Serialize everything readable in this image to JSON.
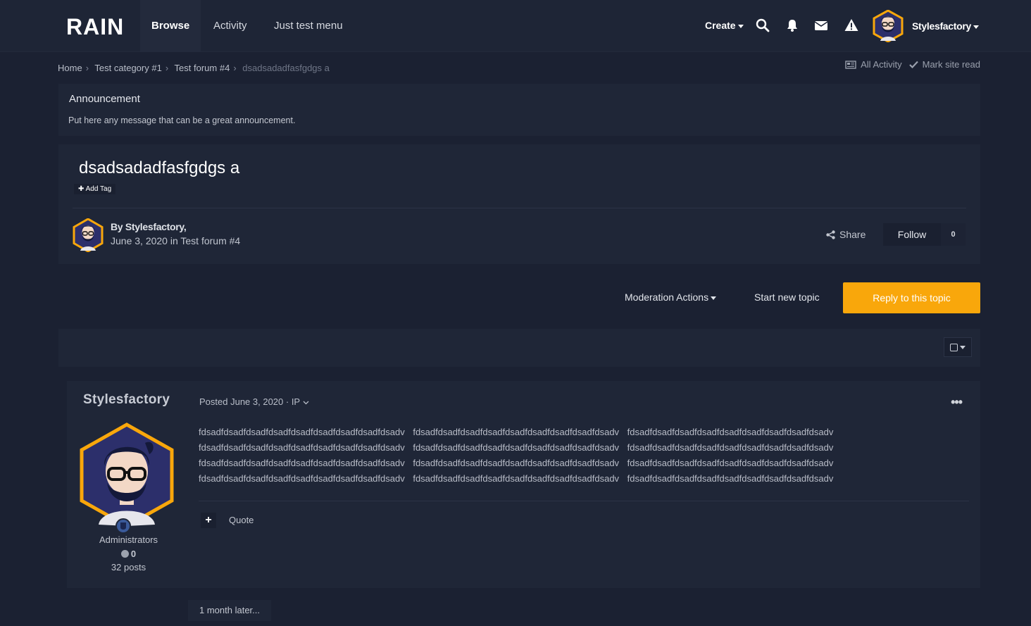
{
  "header": {
    "logo": "RAIN",
    "nav": [
      {
        "label": "Browse",
        "active": true
      },
      {
        "label": "Activity",
        "active": false
      },
      {
        "label": "Just test menu",
        "active": false
      }
    ],
    "create_label": "Create",
    "username": "Stylesfactory",
    "icons": [
      "search-icon",
      "bell-icon",
      "envelope-icon",
      "warning-icon"
    ]
  },
  "breadcrumb": {
    "items": [
      "Home",
      "Test category #1",
      "Test forum #4",
      "dsadsadadfasfgdgs a"
    ],
    "all_activity": "All Activity",
    "mark_read": "Mark site read"
  },
  "announcement": {
    "title": "Announcement",
    "message": "Put here any message that can be a great announcement."
  },
  "topic": {
    "title": "dsadsadadfasfgdgs a",
    "add_tag": "Add Tag",
    "author_by": "By Stylesfactory,",
    "author_meta": "June 3, 2020 in Test forum #4",
    "share_label": "Share",
    "follow_label": "Follow",
    "follow_count": "0"
  },
  "actions": {
    "moderation": "Moderation Actions",
    "start_topic": "Start new topic",
    "reply": "Reply to this topic"
  },
  "post": {
    "author": "Stylesfactory",
    "posted": "Posted June 3, 2020 · IP",
    "menu": "•••",
    "role": "Administrators",
    "reputation": "0",
    "posts": "32 posts",
    "body_lines": [
      "fdsadfdsadfdsadfdsadfdsadfdsadfdsadfdsadfdsadv fdsadfdsadfdsadfdsadfdsadfdsadfdsadfdsadfdsadv fdsadfdsadfdsadfdsadfdsadfdsadfdsadfdsadfdsadv",
      "fdsadfdsadfdsadfdsadfdsadfdsadfdsadfdsadfdsadv fdsadfdsadfdsadfdsadfdsadfdsadfdsadfdsadfdsadv fdsadfdsadfdsadfdsadfdsadfdsadfdsadfdsadfdsadv",
      "fdsadfdsadfdsadfdsadfdsadfdsadfdsadfdsadfdsadv fdsadfdsadfdsadfdsadfdsadfdsadfdsadfdsadfdsadv fdsadfdsadfdsadfdsadfdsadfdsadfdsadfdsadfdsadv",
      "fdsadfdsadfdsadfdsadfdsadfdsadfdsadfdsadfdsadv fdsadfdsadfdsadfdsadfdsadfdsadfdsadfdsadfdsadv fdsadfdsadfdsadfdsadfdsadfdsadfdsadfdsadfdsadv"
    ],
    "plus": "+",
    "quote": "Quote"
  },
  "later_label": "1 month later...",
  "colors": {
    "accent": "#f9a70b",
    "background": "#1b2132",
    "panel": "#1f2637",
    "header": "#1e2536"
  }
}
